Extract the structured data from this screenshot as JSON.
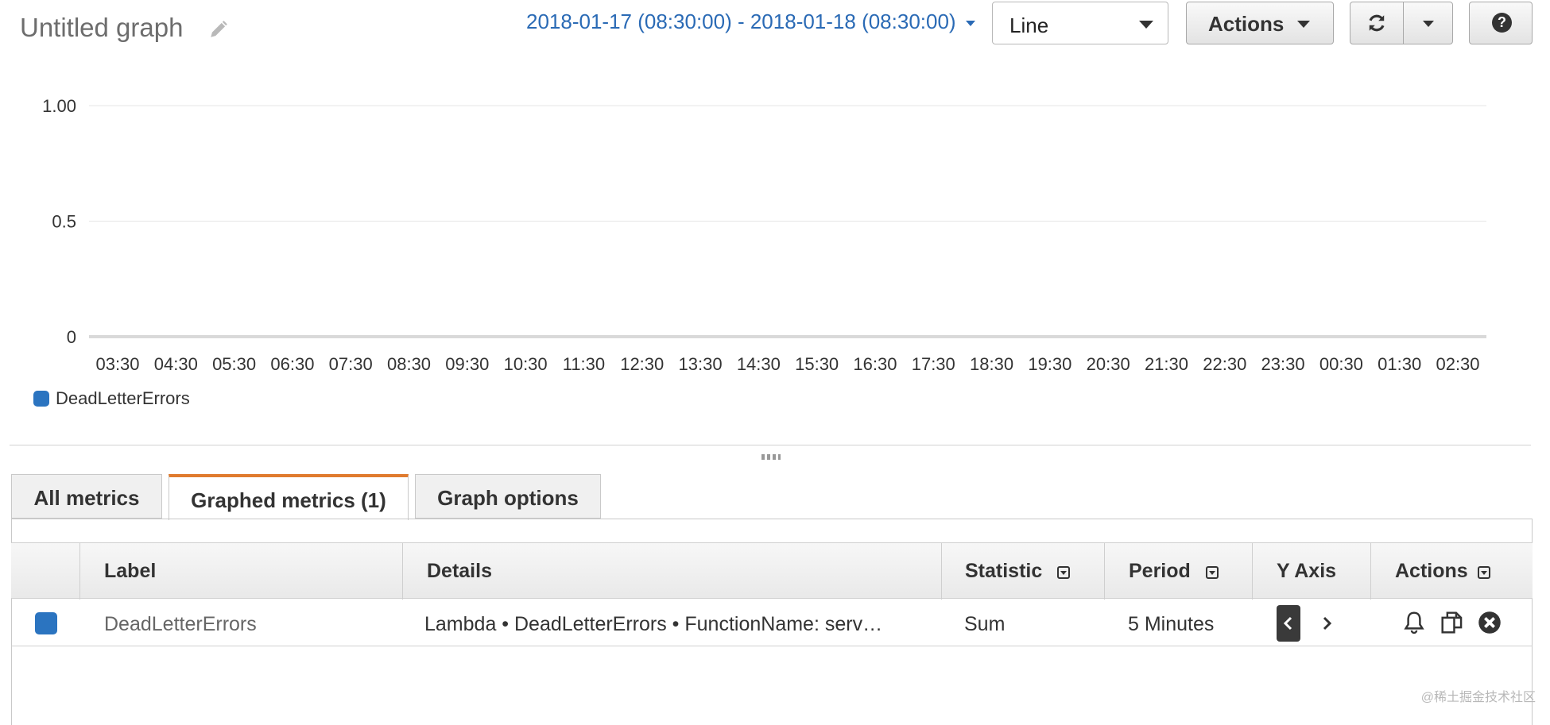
{
  "header": {
    "title": "Untitled graph",
    "date_range": "2018-01-17 (08:30:00) - 2018-01-18 (08:30:00)",
    "graph_type": "Line",
    "actions_label": "Actions",
    "help_label": "?"
  },
  "chart_data": {
    "type": "line",
    "x": [
      "03:30",
      "04:30",
      "05:30",
      "06:30",
      "07:30",
      "08:30",
      "09:30",
      "10:30",
      "11:30",
      "12:30",
      "13:30",
      "14:30",
      "15:30",
      "16:30",
      "17:30",
      "18:30",
      "19:30",
      "20:30",
      "21:30",
      "22:30",
      "23:30",
      "00:30",
      "01:30",
      "02:30"
    ],
    "y_ticks": [
      "1.00",
      "0.5",
      "0"
    ],
    "ylim": [
      0,
      1
    ],
    "series": [
      {
        "name": "DeadLetterErrors",
        "color": "#2b74c0",
        "values": [
          0,
          0,
          0,
          0,
          0,
          0,
          0,
          0,
          0,
          0,
          0,
          0,
          0,
          0,
          0,
          0,
          0,
          0,
          0,
          0,
          0,
          0,
          0,
          0
        ]
      }
    ],
    "grid": true,
    "legend": "bottom-left"
  },
  "tabs": [
    {
      "label": "All metrics"
    },
    {
      "label": "Graphed metrics (1)"
    },
    {
      "label": "Graph options"
    }
  ],
  "table": {
    "columns": [
      "Label",
      "Details",
      "Statistic",
      "Period",
      "Y Axis",
      "Actions"
    ],
    "rows": [
      {
        "color": "#2b74c0",
        "label": "DeadLetterErrors",
        "details": "Lambda • DeadLetterErrors • FunctionName: serv…",
        "statistic": "Sum",
        "period": "5 Minutes"
      }
    ]
  },
  "icons": {
    "edit": "pencil-icon",
    "refresh": "refresh-icon",
    "alarm": "bell-icon",
    "copy": "copy-icon",
    "remove": "close-circle-icon"
  },
  "watermark": "@稀土掘金技术社区"
}
